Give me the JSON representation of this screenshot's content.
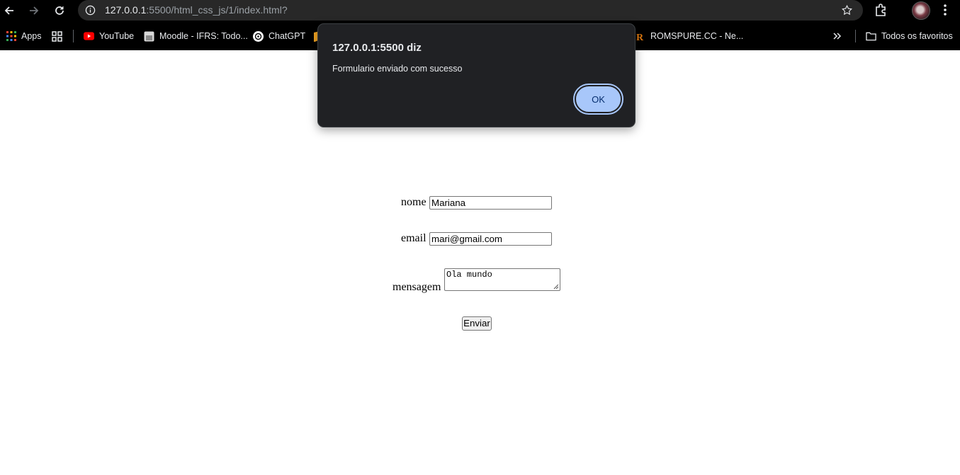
{
  "browser": {
    "url_host": "127.0.0.1",
    "url_rest": ":5500/html_css_js/1/index.html?",
    "bookmarks": [
      {
        "label": "Apps"
      },
      {
        "label": "YouTube"
      },
      {
        "label": "Moodle - IFRS: Todo..."
      },
      {
        "label": "ChatGPT"
      },
      {
        "label": "ROMSPURE.CC - Ne..."
      }
    ],
    "all_bookmarks_label": "Todos os favoritos"
  },
  "form": {
    "nome_label": "nome",
    "nome_value": "Mariana",
    "email_label": "email",
    "email_value": "mari@gmail.com",
    "mensagem_label": "mensagem",
    "mensagem_value": "Ola mundo",
    "submit_label": "Enviar"
  },
  "dialog": {
    "title": "127.0.0.1:5500 diz",
    "message": "Formulario enviado com sucesso",
    "ok_label": "OK"
  },
  "colors": {
    "chrome_bg": "#000000",
    "omnibox_bg": "#282828",
    "dialog_bg": "#202124",
    "ok_button_bg": "#a8c7fa"
  }
}
